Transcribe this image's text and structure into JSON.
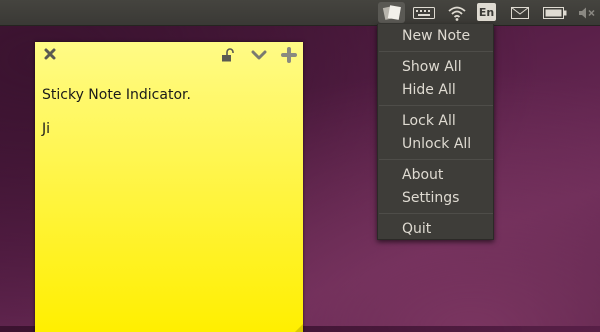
{
  "panel": {
    "indicators": [
      {
        "icon": "sticky-notes-icon"
      },
      {
        "icon": "keyboard-icon"
      },
      {
        "icon": "wifi-icon"
      },
      {
        "icon": "language-icon"
      },
      {
        "icon": "mail-icon"
      },
      {
        "icon": "battery-icon"
      },
      {
        "icon": "volume-muted-icon"
      }
    ],
    "language": "En"
  },
  "note": {
    "text": "Sticky Note Indicator.\n\nJi",
    "color": "#fff54a",
    "icons": [
      "close-icon",
      "lock-icon",
      "chevron-down-icon",
      "plus-icon"
    ]
  },
  "menu": {
    "items": [
      "New Note",
      "Show All",
      "Hide All",
      "Lock All",
      "Unlock All",
      "About",
      "Settings",
      "Quit"
    ]
  }
}
